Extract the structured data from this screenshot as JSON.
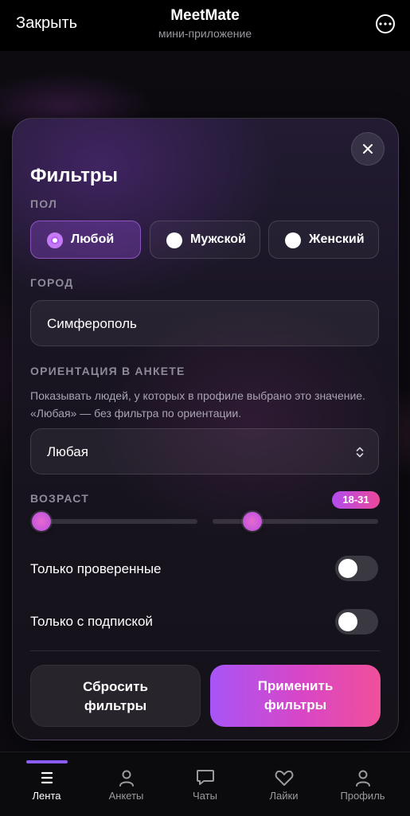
{
  "header": {
    "close_label": "Закрыть",
    "title": "MeetMate",
    "subtitle": "мини-приложение",
    "more_icon": "more-horizontal-icon"
  },
  "filters": {
    "title": "Фильтры",
    "gender": {
      "label": "ПОЛ",
      "options": [
        {
          "label": "Любой",
          "selected": true
        },
        {
          "label": "Мужской",
          "selected": false
        },
        {
          "label": "Женский",
          "selected": false
        }
      ]
    },
    "city": {
      "label": "ГОРОД",
      "value": "Симферополь"
    },
    "orientation": {
      "label": "ОРИЕНТАЦИЯ В АНКЕТЕ",
      "help": "Показывать людей, у которых в профиле выбрано это значение. «Любая» — без фильтра по ориентации.",
      "value": "Любая"
    },
    "age": {
      "label": "ВОЗРАСТ",
      "badge": "18-31",
      "min": 18,
      "max": 31
    },
    "verified_only": {
      "label": "Только проверенные",
      "on": false
    },
    "subscription_only": {
      "label": "Только с подпиской",
      "on": false
    },
    "reset_label": "Сбросить фильтры",
    "apply_label": "Применить фильтры"
  },
  "nav": {
    "items": [
      {
        "label": "Лента",
        "icon": "menu-icon",
        "active": true
      },
      {
        "label": "Анкеты",
        "icon": "user-icon",
        "active": false
      },
      {
        "label": "Чаты",
        "icon": "chat-icon",
        "active": false
      },
      {
        "label": "Лайки",
        "icon": "heart-icon",
        "active": false
      },
      {
        "label": "Профиль",
        "icon": "profile-icon",
        "active": false
      }
    ]
  },
  "colors": {
    "accent": "#a855f7",
    "accent_pink": "#f0509a",
    "background": "#000000"
  }
}
